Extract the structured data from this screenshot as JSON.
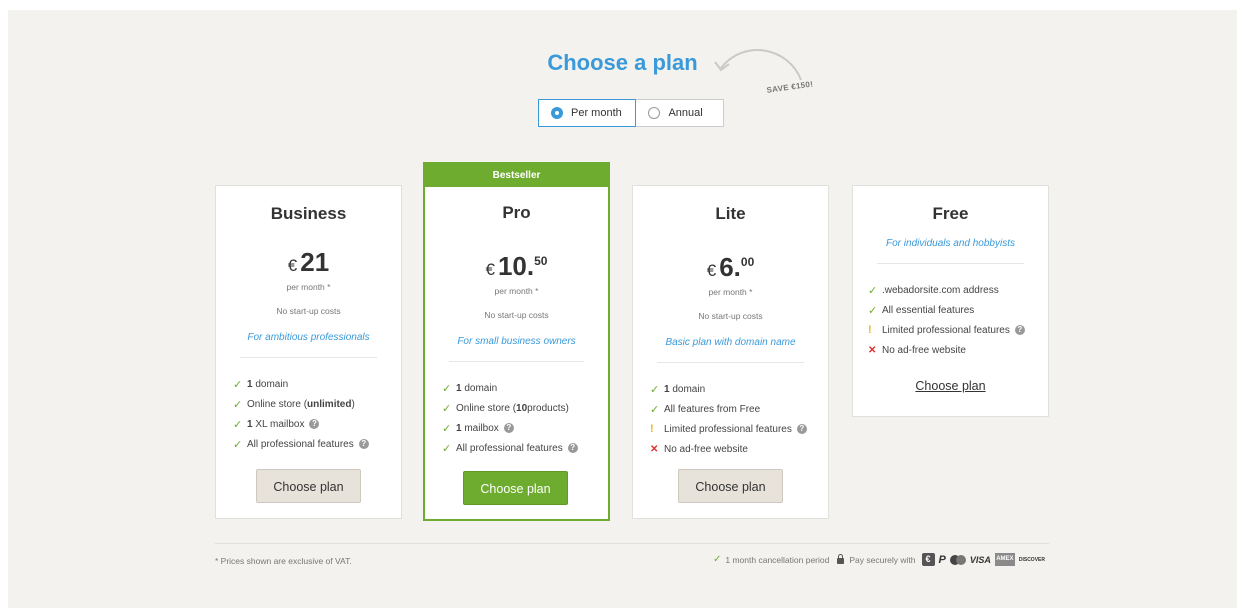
{
  "header": {
    "title": "Choose a plan",
    "save_badge": "SAVE €150!"
  },
  "billing_toggle": {
    "monthly_label": "Per month",
    "annual_label": "Annual",
    "selected": "monthly"
  },
  "plans": [
    {
      "name": "Business",
      "currency": "€",
      "price_main": "21",
      "price_cents": "",
      "per": "per month *",
      "startup": "No start-up costs",
      "tagline": "For ambitious professionals",
      "features": [
        {
          "bold": "1",
          "text": " domain"
        },
        {
          "pre": "Online store (",
          "bold": "unlimited",
          "post": ")"
        },
        {
          "bold": "1",
          "text": " XL mailbox"
        },
        {
          "text": "All professional features"
        }
      ],
      "button": "Choose plan"
    },
    {
      "badge": "Bestseller",
      "name": "Pro",
      "currency": "€",
      "price_main": "10",
      "price_cents": "50",
      "per": "per month *",
      "startup": "No start-up costs",
      "tagline": "For small business owners",
      "features": [
        {
          "bold": "1",
          "text": " domain"
        },
        {
          "pre": "Online store (",
          "bold": "10",
          "post": " products)"
        },
        {
          "bold": "1",
          "text": " mailbox"
        },
        {
          "text": "All professional features"
        }
      ],
      "button": "Choose plan"
    },
    {
      "name": "Lite",
      "currency": "€",
      "price_main": "6",
      "price_cents": "00",
      "per": "per month *",
      "startup": "No start-up costs",
      "tagline": "Basic plan with domain name",
      "features": [
        {
          "bold": "1",
          "text": " domain"
        },
        {
          "text": "All features from Free"
        },
        {
          "text": "Limited professional features"
        },
        {
          "text": "No ad-free website"
        }
      ],
      "button": "Choose plan"
    },
    {
      "name": "Free",
      "tagline": "For individuals and hobbyists",
      "features": [
        {
          "text": ".webadorsite.com address"
        },
        {
          "text": "All essential features"
        },
        {
          "text": "Limited professional features"
        },
        {
          "text": "No ad-free website"
        }
      ],
      "button": "Choose plan"
    }
  ],
  "footer": {
    "vat_note": "* Prices shown are exclusive of VAT.",
    "cancellation": "1 month cancellation period",
    "pay_securely": "Pay securely with",
    "payment_methods": [
      "€",
      "P",
      "",
      "VISA",
      "AMEX",
      "DISCOVER"
    ]
  },
  "colors": {
    "accent": "#3a9ad9",
    "green": "#6eac2f",
    "background": "#f3f2ee"
  }
}
